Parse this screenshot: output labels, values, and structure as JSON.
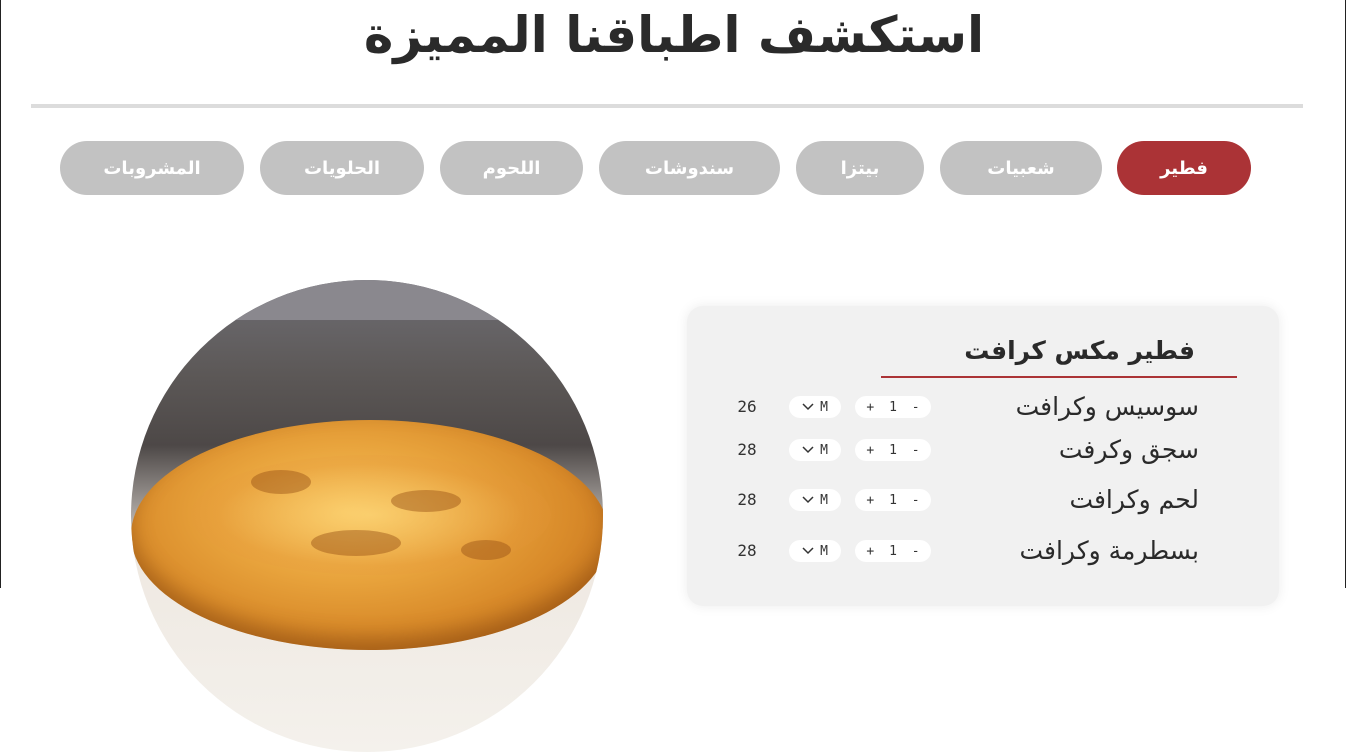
{
  "page": {
    "title": "استكشف اطباقنا المميزة"
  },
  "categories": [
    {
      "label": "فطير",
      "active": true
    },
    {
      "label": "شعبيات",
      "active": false
    },
    {
      "label": "بيتزا",
      "active": false
    },
    {
      "label": "سندوشات",
      "active": false
    },
    {
      "label": "اللحوم",
      "active": false
    },
    {
      "label": "الحلويات",
      "active": false
    },
    {
      "label": "المشروبات",
      "active": false
    }
  ],
  "menu": {
    "title": "فطير مكس كرافت",
    "items": [
      {
        "name": "سوسيس وكرافت",
        "minus": "-",
        "qty": "1",
        "plus": "+",
        "size": "M",
        "price": "26"
      },
      {
        "name": "سجق وكرفت",
        "minus": "-",
        "qty": "1",
        "plus": "+",
        "size": "M",
        "price": "28"
      },
      {
        "name": "لحم وكرافت",
        "minus": "-",
        "qty": "1",
        "plus": "+",
        "size": "M",
        "price": "28"
      },
      {
        "name": "بسطرمة وكرافت",
        "minus": "-",
        "qty": "1",
        "plus": "+",
        "size": "M",
        "price": "28"
      }
    ]
  },
  "colors": {
    "accent": "#ab3336",
    "inactive_pill": "#c2c2c2",
    "card_bg": "#f1f1f1"
  },
  "icons": {
    "size_dropdown": "chevron-down-icon"
  }
}
